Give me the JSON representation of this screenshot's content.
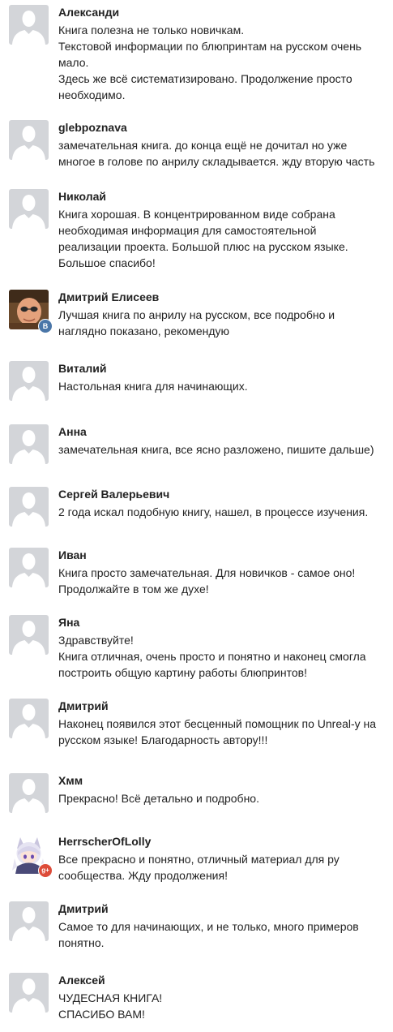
{
  "colors": {
    "placeholder_bg": "#d3d5d9",
    "placeholder_fg": "#ffffff",
    "vk_badge": "#4a76a8",
    "gplus_badge": "#dd4b39"
  },
  "comments": [
    {
      "author": "Александи",
      "avatar": "default-avatar-icon",
      "lines": [
        "Книга полезна не только новичкам.",
        "Текстовой информации по блюпринтам на русском очень",
        "мало.",
        "Здесь же всё систематизировано. Продолжение просто",
        "необходимо."
      ]
    },
    {
      "author": "glebpoznava",
      "avatar": "default-avatar-icon",
      "lines": [
        "замечательная книга. до конца ещё не дочитал но уже",
        "многое в голове по анрилу складывается. жду вторую часть"
      ]
    },
    {
      "author": "Николай",
      "avatar": "default-avatar-icon",
      "lines": [
        "Книга хорошая. В концентрированном виде собрана",
        "необходимая информация для самостоятельной",
        "реализации проекта. Большой плюс на русском языке.",
        "Большое спасибо!"
      ]
    },
    {
      "author": "Дмитрий Елисеев",
      "avatar": "user-photo",
      "badge": "В",
      "lines": [
        "Лучшая книга по анрилу на русском, все подробно и",
        "наглядно показано, рекомендую"
      ]
    },
    {
      "author": "Виталий",
      "avatar": "default-avatar-icon",
      "lines": [
        "Настольная книга для начинающих."
      ]
    },
    {
      "author": "Анна",
      "avatar": "default-avatar-icon",
      "lines": [
        "замечательная книга, все ясно разложено, пишите дальше)"
      ]
    },
    {
      "author": "Сергей Валерьевич",
      "avatar": "default-avatar-icon",
      "lines": [
        "2 года искал подобную книгу, нашел, в процессе изучения."
      ]
    },
    {
      "author": "Иван",
      "avatar": "default-avatar-icon",
      "lines": [
        "Книга просто замечательная. Для новичков - самое оно!",
        "Продолжайте в том же духе!"
      ]
    },
    {
      "author": "Яна",
      "avatar": "default-avatar-icon",
      "lines": [
        "Здравствуйте!",
        "Книга отличная, очень просто и понятно и наконец смогла",
        "построить общую картину работы блюпринтов!"
      ]
    },
    {
      "author": "Дмитрий",
      "avatar": "default-avatar-icon",
      "lines": [
        "Наконец появился этот бесценный помощник по Unreal-у на",
        "русском языке! Благодарность автору!!!"
      ]
    },
    {
      "author": "Хмм",
      "avatar": "default-avatar-icon",
      "lines": [
        "Прекрасно! Всё детально и подробно."
      ]
    },
    {
      "author": "HerrscherOfLolly",
      "avatar": "anime-avatar",
      "badge": "g+",
      "lines": [
        "Все прекрасно и понятно, отличный материал для ру",
        "сообщества. Жду продолжения!"
      ]
    },
    {
      "author": "Дмитрий",
      "avatar": "default-avatar-icon",
      "lines": [
        "Самое то для начинающих, и не только, много примеров",
        "понятно."
      ]
    },
    {
      "author": "Алексей",
      "avatar": "default-avatar-icon",
      "lines": [
        "ЧУДЕСНАЯ КНИГА!",
        "СПАСИБО ВАМ!"
      ]
    }
  ]
}
